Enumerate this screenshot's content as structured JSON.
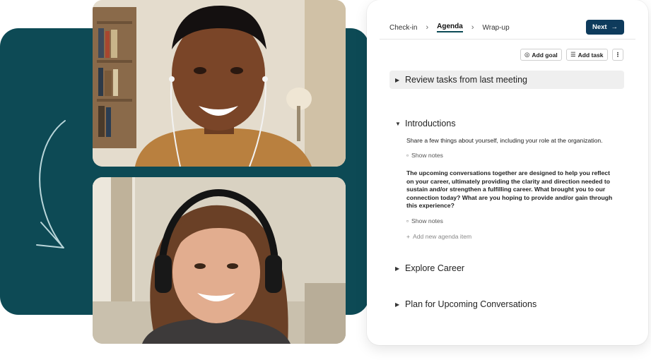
{
  "breadcrumb": {
    "steps": [
      "Check-in",
      "Agenda",
      "Wrap-up"
    ],
    "active_index": 1
  },
  "toolbar": {
    "next_label": "Next",
    "add_goal_label": "Add goal",
    "add_task_label": "Add task"
  },
  "agenda": {
    "sections": [
      {
        "title": "Review tasks from last meeting",
        "expanded": false
      },
      {
        "title": "Introductions",
        "expanded": true
      },
      {
        "title": "Explore Career",
        "expanded": false
      },
      {
        "title": "Plan for Upcoming Conversations",
        "expanded": false
      }
    ],
    "introductions": {
      "item1": "Share a few things about yourself, including your role at the organization.",
      "item2": "The upcoming conversations together are designed to help you reflect on your career, ultimately providing the clarity and direction needed to sustain and/or strengthen a fulfilling career. What brought you to our connection today? What are you hoping to provide and/or gain through this experience?",
      "show_notes": "Show notes",
      "add_item": "Add new agenda item"
    }
  },
  "colors": {
    "teal_background": "#0d4a55",
    "next_button": "#0e3b5c",
    "section_shade": "#efefef"
  }
}
